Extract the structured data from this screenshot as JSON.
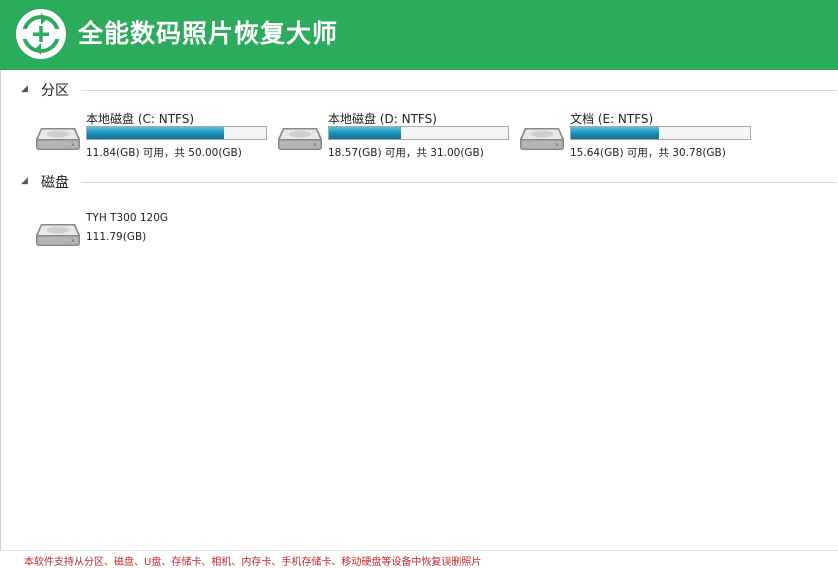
{
  "app": {
    "title": "全能数码照片恢复大师",
    "header_color": "#2dab5c"
  },
  "partitions": {
    "group_label": "分区",
    "items": [
      {
        "name": "本地磁盘 (C: NTFS)",
        "space": "11.84(GB) 可用，共 50.00(GB)",
        "used_fraction": 0.763,
        "icon": "hard-drive-icon"
      },
      {
        "name": "本地磁盘 (D: NTFS)",
        "space": "18.57(GB) 可用，共 31.00(GB)",
        "used_fraction": 0.401,
        "icon": "hard-drive-icon"
      },
      {
        "name": "文档 (E: NTFS)",
        "space": "15.64(GB) 可用，共 30.78(GB)",
        "used_fraction": 0.492,
        "icon": "hard-drive-icon"
      }
    ]
  },
  "disks": {
    "group_label": "磁盘",
    "items": [
      {
        "name": "TYH T300 120G",
        "size": "111.79(GB)",
        "icon": "hard-drive-icon"
      }
    ]
  },
  "footer": {
    "text": "本软件支持从分区、磁盘、U盘、存储卡、相机、内存卡、手机存储卡、移动硬盘等设备中恢复误删照片"
  },
  "colors": {
    "bar_fill": "#1d8bb6",
    "footer_text": "#c62828"
  }
}
